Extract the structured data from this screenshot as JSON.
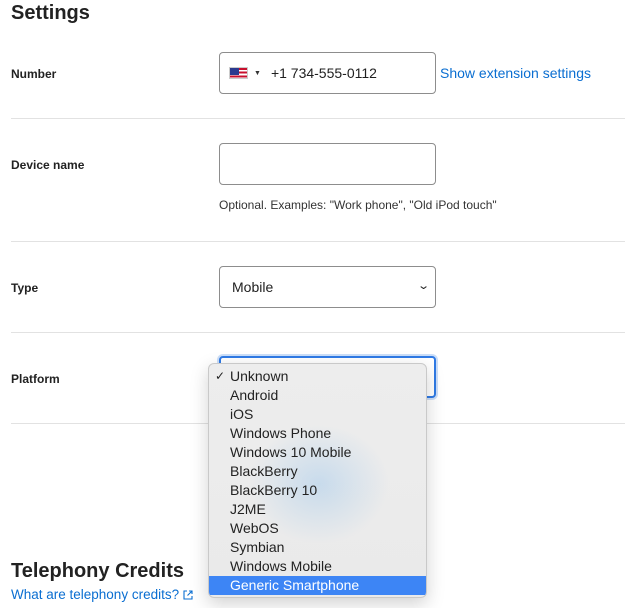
{
  "settings": {
    "title": "Settings",
    "number": {
      "label": "Number",
      "country_flag": "us-flag-icon",
      "value": "+1 734-555-0112",
      "extension_link": "Show extension settings"
    },
    "device_name": {
      "label": "Device name",
      "value": "",
      "placeholder": "",
      "hint": "Optional. Examples: \"Work phone\", \"Old iPod touch\""
    },
    "type": {
      "label": "Type",
      "selected": "Mobile"
    },
    "platform": {
      "label": "Platform",
      "selected": "Unknown",
      "options": [
        "Unknown",
        "Android",
        "iOS",
        "Windows Phone",
        "Windows 10 Mobile",
        "BlackBerry",
        "BlackBerry 10",
        "J2ME",
        "WebOS",
        "Symbian",
        "Windows Mobile",
        "Generic Smartphone"
      ],
      "highlighted": "Generic Smartphone",
      "checkmark": "✓"
    }
  },
  "telephony": {
    "title": "Telephony Credits",
    "link": "What are telephony credits?"
  },
  "colors": {
    "link": "#0a6ed1",
    "focus": "#2f7ae5",
    "highlight": "#3d85f5"
  }
}
